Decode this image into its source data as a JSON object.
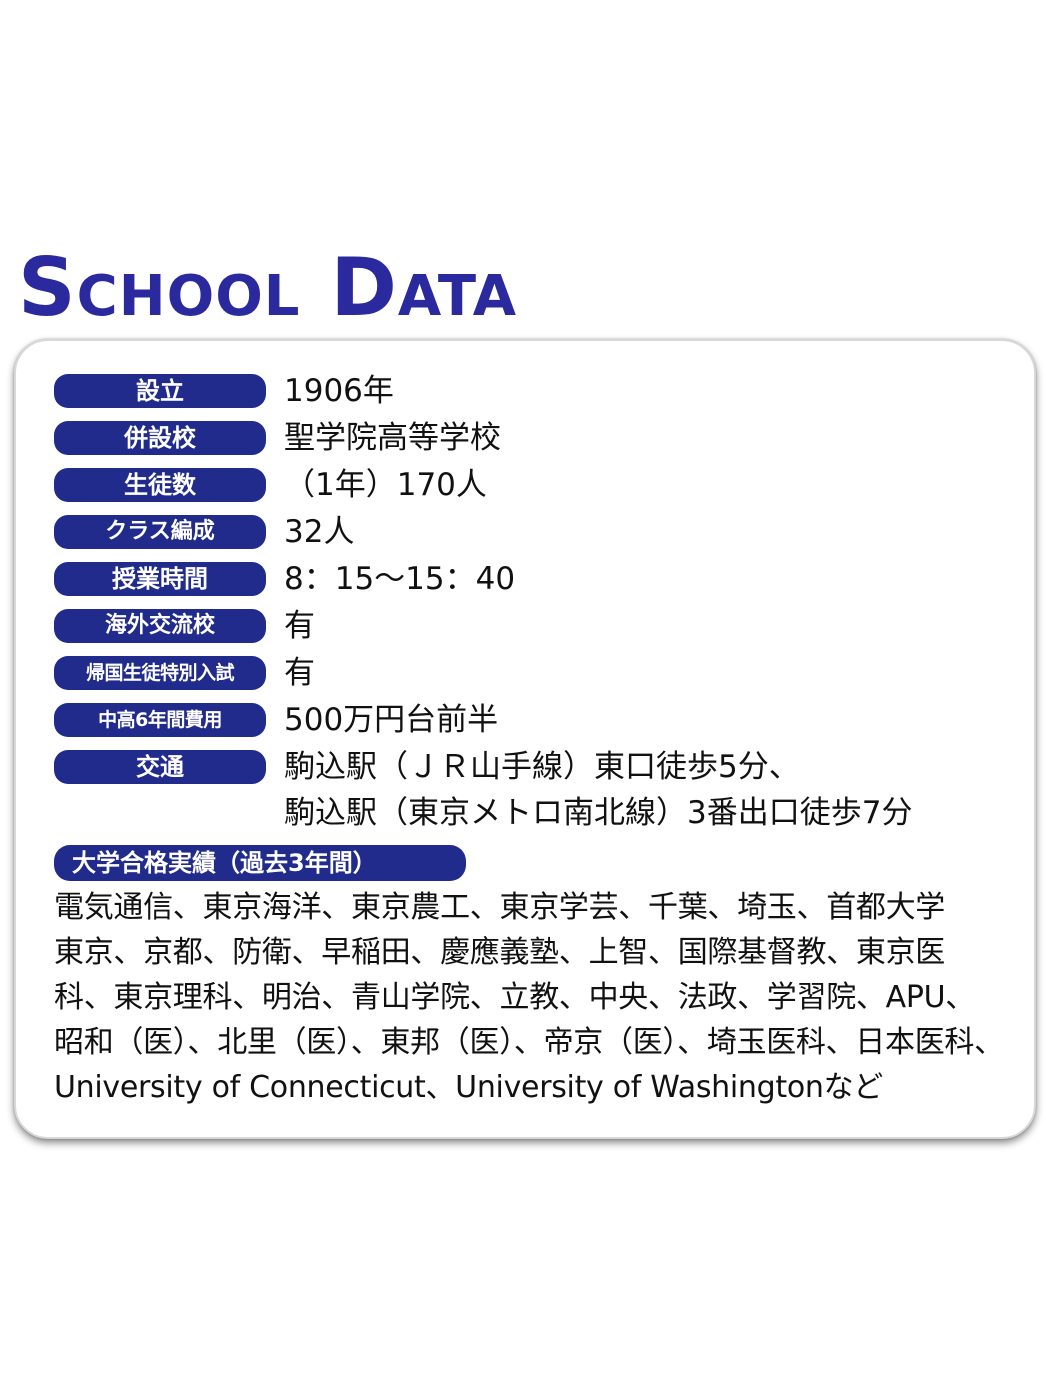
{
  "heading": {
    "word1_initial": "S",
    "word1_rest": "CHOOL",
    "word2_initial": "D",
    "word2_rest": "ATA"
  },
  "rows": [
    {
      "label": "設立",
      "value": "1906年"
    },
    {
      "label": "併設校",
      "value": "聖学院高等学校"
    },
    {
      "label": "生徒数",
      "value": "（1年）170人"
    },
    {
      "label": "クラス編成",
      "value": "32人"
    },
    {
      "label": "授業時間",
      "value": "8：15～15：40"
    },
    {
      "label": "海外交流校",
      "value": "有"
    },
    {
      "label": "帰国生徒特別入試",
      "value": "有"
    },
    {
      "label": "中高6年間費用",
      "value": "500万円台前半"
    },
    {
      "label": "交通",
      "value": "駒込駅（ＪＲ山手線）東口徒歩5分、",
      "value2": "駒込駅（東京メトロ南北線）3番出口徒歩7分"
    }
  ],
  "results": {
    "label": "大学合格実績（過去3年間）",
    "lines": [
      "電気通信、東京海洋、東京農工、東京学芸、千葉、埼玉、首都大学",
      "東京、京都、防衛、早稲田、慶應義塾、上智、国際基督教、東京医",
      "科、東京理科、明治、青山学院、立教、中央、法政、学習院、APU、",
      "昭和（医）、北里（医）、東邦（医）、帝京（医）、埼玉医科、日本医科、",
      "University of Connecticut、University of Washingtonなど"
    ]
  }
}
